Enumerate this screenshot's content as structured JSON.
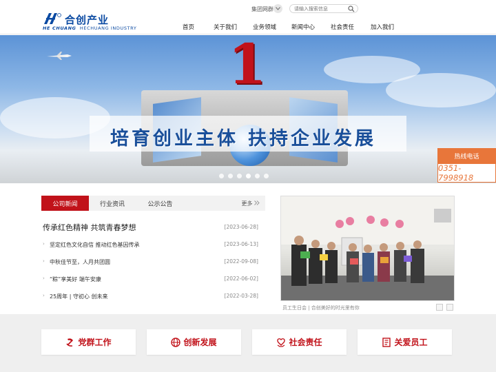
{
  "header": {
    "logo_cn": "合创产业",
    "logo_en_brand": "HE CHUANG",
    "logo_en_name": "HECHUANG INDUSTRY",
    "group_net": "集团网群",
    "search_placeholder": "请输入搜索信息",
    "nav": [
      "首页",
      "关于我们",
      "业务领域",
      "新闻中心",
      "社会责任",
      "加入我们"
    ]
  },
  "banner": {
    "big_number": "1",
    "slogan_part1": "培育创业主体",
    "slogan_part2": "扶持企业发展",
    "slide_count": 6,
    "active_slide": 3,
    "hotline_label": "热线电话",
    "hotline_number": "0351-7998918"
  },
  "news": {
    "tabs": [
      "公司新闻",
      "行业资讯",
      "公示公告"
    ],
    "active_tab": 0,
    "more": "更多",
    "headline": {
      "title": "传承红色精神 共筑青春梦想",
      "date": "[2023-06-28]"
    },
    "items": [
      {
        "title": "坚定红色文化自信 推动红色基因传承",
        "date": "[2023-06-13]"
      },
      {
        "title": "中秋佳节至，人月共团圆",
        "date": "[2022-09-08]"
      },
      {
        "title": "“粽”享美好 端午安康",
        "date": "[2022-06-02]"
      },
      {
        "title": "25周年 | 守初心 创未来",
        "date": "[2022-03-28]"
      }
    ]
  },
  "photo": {
    "caption": "员工生日会 | 合创美好的时光里有你"
  },
  "features": [
    {
      "label": "党群工作",
      "icon": "party-icon"
    },
    {
      "label": "创新发展",
      "icon": "globe-icon"
    },
    {
      "label": "社会责任",
      "icon": "hands-icon"
    },
    {
      "label": "关爱员工",
      "icon": "book-icon"
    }
  ],
  "colors": {
    "brand_blue": "#0b4aa2",
    "accent_red": "#c1121a",
    "hotline_orange": "#e8763a"
  }
}
